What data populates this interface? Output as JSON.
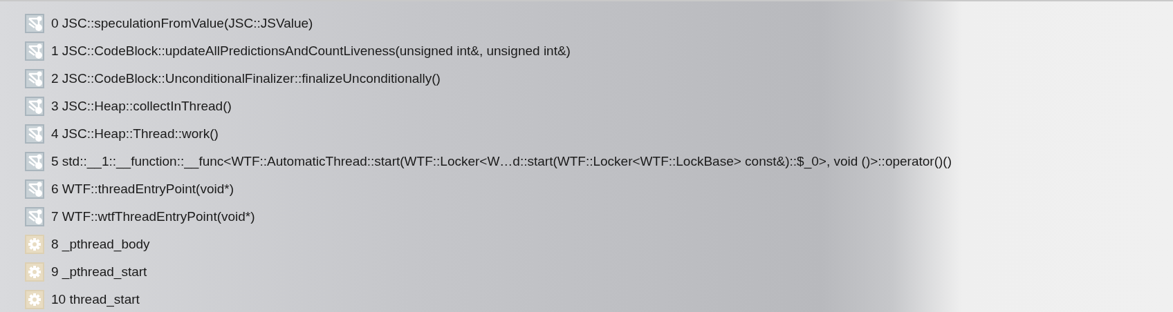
{
  "frames": [
    {
      "kind": "symbol",
      "label": "0 JSC::speculationFromValue(JSC::JSValue)"
    },
    {
      "kind": "symbol",
      "label": "1 JSC::CodeBlock::updateAllPredictionsAndCountLiveness(unsigned int&, unsigned int&)"
    },
    {
      "kind": "symbol",
      "label": "2 JSC::CodeBlock::UnconditionalFinalizer::finalizeUnconditionally()"
    },
    {
      "kind": "symbol",
      "label": "3 JSC::Heap::collectInThread()"
    },
    {
      "kind": "symbol",
      "label": "4 JSC::Heap::Thread::work()"
    },
    {
      "kind": "symbol",
      "label": "5 std::__1::__function::__func<WTF::AutomaticThread::start(WTF::Locker<W…d::start(WTF::Locker<WTF::LockBase> const&)::$_0>, void ()>::operator()()"
    },
    {
      "kind": "symbol",
      "label": "6 WTF::threadEntryPoint(void*)"
    },
    {
      "kind": "symbol",
      "label": "7 WTF::wtfThreadEntryPoint(void*)"
    },
    {
      "kind": "system",
      "label": "8 _pthread_body"
    },
    {
      "kind": "system",
      "label": "9 _pthread_start"
    },
    {
      "kind": "system",
      "label": "10 thread_start"
    }
  ]
}
